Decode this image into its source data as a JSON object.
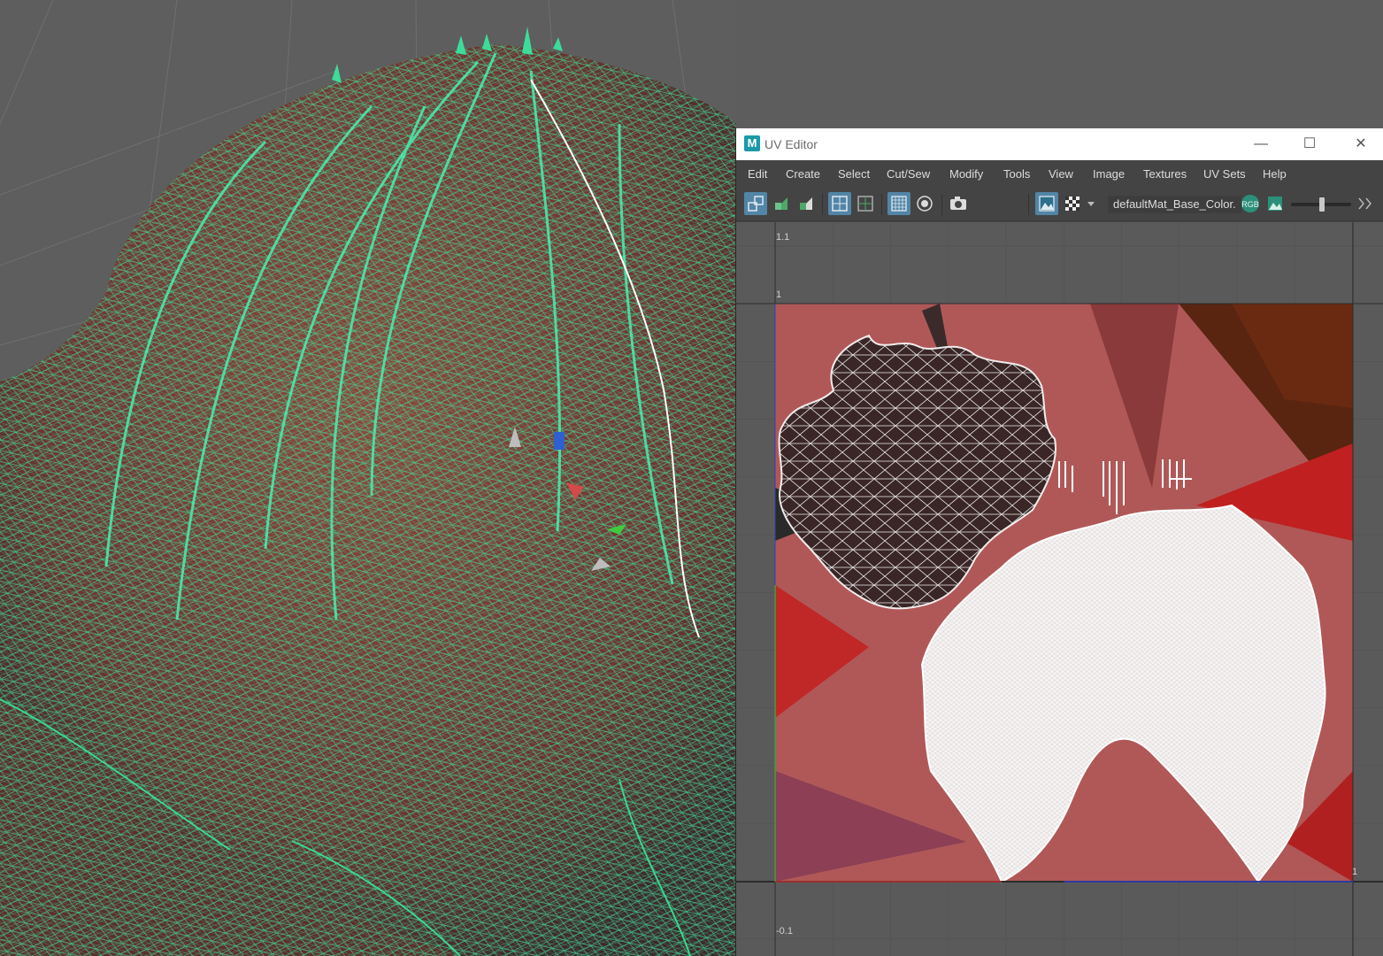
{
  "uv_editor": {
    "title": "UV Editor",
    "logo_letter": "M",
    "window_controls": {
      "minimize": "—",
      "maximize": "☐",
      "close": "✕"
    },
    "menu": [
      "Edit",
      "Create",
      "Select",
      "Cut/Sew",
      "Modify",
      "Tools",
      "View",
      "Image",
      "Textures",
      "UV Sets",
      "Help"
    ],
    "toolbar": {
      "texture_name": "defaultMat_Base_Color.",
      "rgb_label": "RGB",
      "icons": [
        "uv-shell-icon",
        "flip-u-icon",
        "flip-v-icon",
        "grid-snap-icon",
        "grid-toggle-icon",
        "pixel-grid-icon",
        "isolate-icon",
        "snapshot-icon",
        "display-image-icon",
        "checker-icon",
        "dropdown-arrow-icon",
        "rgb-channel-icon",
        "exposure-icon",
        "more-arrow-icon"
      ],
      "active_buttons": [
        "uv-shell-icon",
        "grid-snap-icon",
        "pixel-grid-icon",
        "display-image-icon"
      ]
    },
    "axis_labels": {
      "top_1_1": "1.1",
      "top_1": "1",
      "bottom_neg": "-0.1",
      "right_1": "1"
    }
  },
  "viewport": {
    "wireframe_color": "#3ddc9a",
    "mesh_color": "#7a3a32",
    "grid_color": "#707070"
  },
  "colors": {
    "title_bar": "#ffffff",
    "panel": "#444444",
    "active_button": "#5285a6",
    "uv_texture": "#b05858",
    "uv_wire": "#ffffff"
  }
}
